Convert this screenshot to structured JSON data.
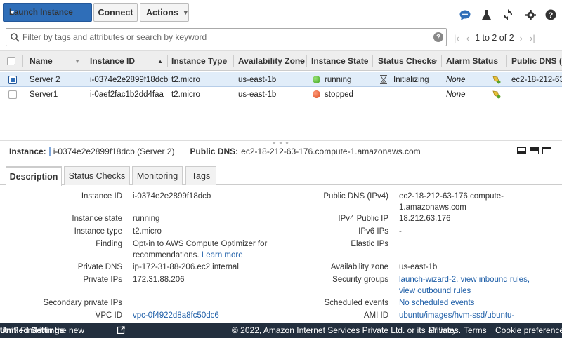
{
  "toolbar": {
    "launch_label": "Launch Instance",
    "connect_label": "Connect",
    "actions_label": "Actions",
    "icons": [
      "chat-icon",
      "flask-icon",
      "refresh-icon",
      "settings-gear-icon",
      "help-icon"
    ]
  },
  "search": {
    "placeholder": "Filter by tags and attributes or search by keyword",
    "pager_text": "1 to 2 of 2"
  },
  "table": {
    "columns": [
      "Name",
      "Instance ID",
      "Instance Type",
      "Availability Zone",
      "Instance State",
      "Status Checks",
      "Alarm Status",
      "Public DNS (I"
    ],
    "rows": [
      {
        "name": "Server 2",
        "id": "i-0374e2e2899f18dcb",
        "type": "t2.micro",
        "zone": "us-east-1b",
        "state": "running",
        "state_color": "#3aa118",
        "checks": "Initializing",
        "alarm": "None",
        "dns": "ec2-18-212-63",
        "selected": true
      },
      {
        "name": "Server1",
        "id": "i-0aef2fac1b2dd4faa",
        "type": "t2.micro",
        "zone": "us-east-1b",
        "state": "stopped",
        "state_color": "#d9481c",
        "checks": "",
        "alarm": "None",
        "dns": "",
        "selected": false
      }
    ]
  },
  "detail": {
    "instance_label": "Instance:",
    "instance_value": "i-0374e2e2899f18dcb (Server 2)",
    "dns_label": "Public DNS:",
    "dns_value": "ec2-18-212-63-176.compute-1.amazonaws.com",
    "tabs": [
      "Description",
      "Status Checks",
      "Monitoring",
      "Tags"
    ],
    "left": [
      {
        "label": "Instance ID",
        "value": "i-0374e2e2899f18dcb"
      },
      {
        "label": "Instance state",
        "value": "running"
      },
      {
        "label": "Instance type",
        "value": "t2.micro"
      },
      {
        "label": "Finding",
        "value": "Opt-in to AWS Compute Optimizer for",
        "value2": "recommendations.",
        "link": "Learn more"
      },
      {
        "label": "Private DNS",
        "value": "ip-172-31-88-206.ec2.internal"
      },
      {
        "label": "Private IPs",
        "value": "172.31.88.206"
      },
      {
        "label": "Secondary private IPs",
        "value": ""
      },
      {
        "label": "VPC ID",
        "value": "vpc-0f4922d8a8fc50dc6"
      }
    ],
    "right": [
      {
        "label": "Public DNS (IPv4)",
        "value": "ec2-18-212-63-176.compute-",
        "value2": "1.amazonaws.com"
      },
      {
        "label": "IPv4 Public IP",
        "value": "18.212.63.176"
      },
      {
        "label": "IPv6 IPs",
        "value": "-"
      },
      {
        "label": "Elastic IPs",
        "value": ""
      },
      {
        "label": "Availability zone",
        "value": "us-east-1b"
      },
      {
        "label": "Security groups",
        "value": "launch-wizard-2.",
        "link": "view inbound rules,",
        "value2": "view outbound rules"
      },
      {
        "label": "Scheduled events",
        "value": "No scheduled events"
      },
      {
        "label": "AMI ID",
        "value": "ubuntu/images/hvm-ssd/ubuntu-"
      }
    ]
  },
  "footer": {
    "left_text": "tion? Find it in the new",
    "left_link": "Unified Settings",
    "copyright": "© 2022, Amazon Internet Services Private Ltd. or its affiliates.",
    "privacy": "Privacy",
    "terms": "Terms",
    "cookies": "Cookie preferences"
  }
}
